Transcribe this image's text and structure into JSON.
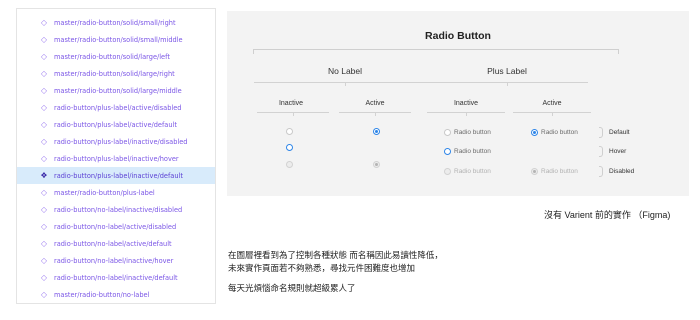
{
  "layers_panel": {
    "rows": [
      {
        "label": "master/radio-button/solid/small/right",
        "icon": "component-instance-icon",
        "selected": false
      },
      {
        "label": "master/radio-button/solid/small/middle",
        "icon": "component-instance-icon",
        "selected": false
      },
      {
        "label": "master/radio-button/solid/large/left",
        "icon": "component-instance-icon",
        "selected": false
      },
      {
        "label": "master/radio-button/solid/large/right",
        "icon": "component-instance-icon",
        "selected": false
      },
      {
        "label": "master/radio-button/solid/large/middle",
        "icon": "component-instance-icon",
        "selected": false
      },
      {
        "label": "radio-button/plus-label/active/disabled",
        "icon": "component-instance-icon",
        "selected": false
      },
      {
        "label": "radio-button/plus-label/active/default",
        "icon": "component-instance-icon",
        "selected": false
      },
      {
        "label": "radio-button/plus-label/inactive/disabled",
        "icon": "component-instance-icon",
        "selected": false
      },
      {
        "label": "radio-button/plus-label/inactive/hover",
        "icon": "component-instance-icon",
        "selected": false
      },
      {
        "label": "radio-button/plus-label/inactive/default",
        "icon": "component-icon",
        "selected": true
      },
      {
        "label": "master/radio-button/plus-label",
        "icon": "component-instance-icon",
        "selected": false
      },
      {
        "label": "radio-button/no-label/inactive/disabled",
        "icon": "component-instance-icon",
        "selected": false
      },
      {
        "label": "radio-button/no-label/active/disabled",
        "icon": "component-instance-icon",
        "selected": false
      },
      {
        "label": "radio-button/no-label/active/default",
        "icon": "component-instance-icon",
        "selected": false
      },
      {
        "label": "radio-button/no-label/inactive/hover",
        "icon": "component-instance-icon",
        "selected": false
      },
      {
        "label": "radio-button/no-label/inactive/default",
        "icon": "component-instance-icon",
        "selected": false
      },
      {
        "label": "master/radio-button/no-label",
        "icon": "component-instance-icon",
        "selected": false
      }
    ]
  },
  "canvas": {
    "title": "Radio Button",
    "groups": [
      "No Label",
      "Plus Label"
    ],
    "states": [
      "Inactive",
      "Active",
      "Inactive",
      "Active"
    ],
    "radio_label": "Radio button",
    "row_labels": [
      "Default",
      "Hover",
      "Disabled"
    ]
  },
  "caption": "沒有 Varient 前的實作 （Figma)",
  "notes": {
    "line1": "在圖層裡看到為了控制各種狀態 而名稱因此易讀性降低，",
    "line2": "未來實作頁面若不夠熟悉，尋找元件困難度也增加",
    "line3": "每天光煩惱命名規則就超級累人了"
  },
  "colors": {
    "layer_text": "#7a55e6",
    "selected_row": "#d8ebfb",
    "radio_active": "#2f86e8",
    "canvas_bg": "#f3f3f3"
  }
}
